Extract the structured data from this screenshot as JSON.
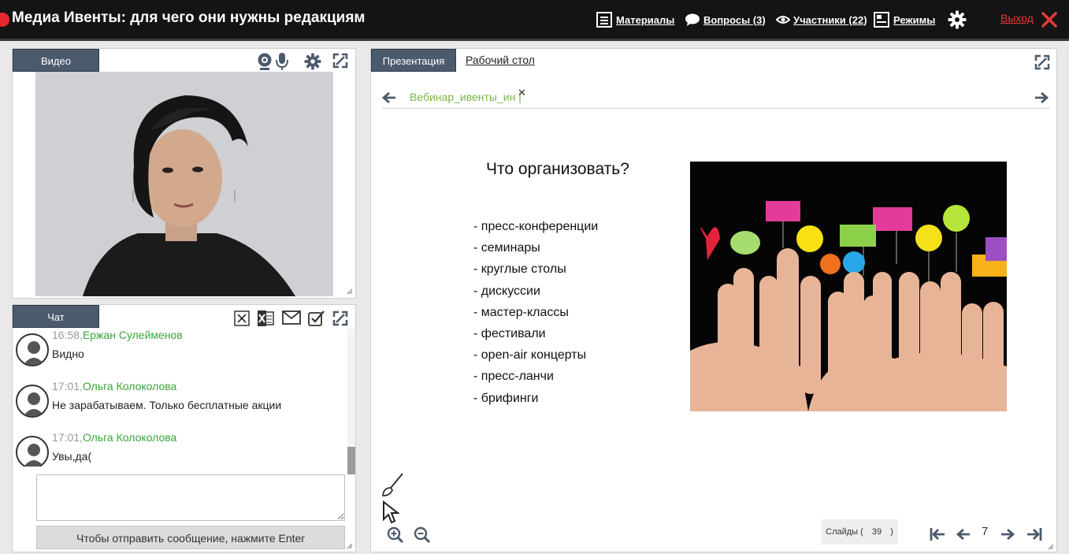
{
  "header": {
    "title": "Медиа Ивенты: для чего они нужны редакциям",
    "nav": {
      "materials": "Материалы",
      "questions": "Вопросы (3)",
      "participants": "Участники (22)",
      "modes": "Режимы"
    },
    "exit": "Выход"
  },
  "video_panel": {
    "tab_label": "Видео"
  },
  "chat_panel": {
    "tab_label": "Чат",
    "messages": [
      {
        "time": "16:58,",
        "author": "Ержан Сулейменов",
        "text": "Видно"
      },
      {
        "time": "17:01,",
        "author": "Ольга Колоколова",
        "text": "Не зарабатываем. Только бесплатные акции"
      },
      {
        "time": "17:01,",
        "author": "Ольга Колоколова",
        "text": "Увы,да("
      }
    ],
    "send_hint": "Чтобы отправить сообщение, нажмите Enter"
  },
  "presentation_panel": {
    "tabs": {
      "presentation": "Презентация",
      "desktop": "Рабочий стол"
    },
    "document_tab": "Вебинар_ивенты_ин",
    "slide": {
      "title": "Что организовать?",
      "items": [
        "- пресс-конференции",
        "- семинары",
        "- круглые столы",
        "- дискуссии",
        "- мастер-классы",
        "- фестивали",
        "- open-air концерты",
        "- пресс-ланчи",
        "- брифинги"
      ]
    },
    "slides_label": "Слайды (",
    "slides_total": "39",
    "slides_close": ")",
    "current_page": "7"
  }
}
